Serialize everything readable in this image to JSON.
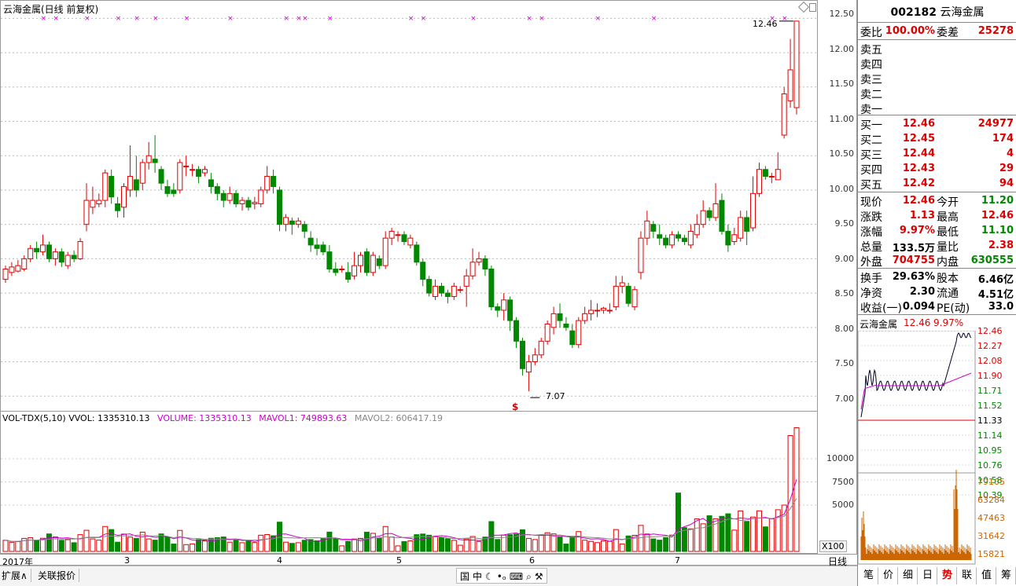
{
  "chart_header": {
    "title": "云海金属(日线 前复权)"
  },
  "price_axis": {
    "ticks": [
      "12.50",
      "12.00",
      "11.50",
      "11.00",
      "10.50",
      "10.00",
      "9.50",
      "9.00",
      "8.50",
      "8.00",
      "7.50",
      "7.00"
    ]
  },
  "vol_header": {
    "name": "VOL-TDX(5,10)",
    "vvol": "VVOL: 1335310.13",
    "volume": "VOLUME: 1335310.13",
    "mavol1": "MAVOL1: 749893.63",
    "mavol2": "MAVOL2: 606417.19"
  },
  "vol_axis": {
    "ticks": [
      "10000",
      "7500",
      "5000"
    ],
    "unit": "X100"
  },
  "annotations": {
    "high_label": "12.46",
    "low_label": "7.07",
    "signal": "$"
  },
  "dates": [
    "2017年",
    "3",
    "4",
    "5",
    "6",
    "7"
  ],
  "bottom_bar": {
    "left_buttons": [
      "扩展∧",
      "关联报价"
    ],
    "right_label": "日线",
    "tools": [
      "国",
      "中",
      "☾",
      "•ₒ",
      "⌨",
      "⌕",
      "⚒"
    ]
  },
  "quote": {
    "code": "002182",
    "name": "云海金属",
    "weibi_label": "委比",
    "weibi": "100.00%",
    "weicha_label": "委差",
    "weicha": "25278",
    "asks": [
      {
        "label": "卖五"
      },
      {
        "label": "卖四"
      },
      {
        "label": "卖三"
      },
      {
        "label": "卖二"
      },
      {
        "label": "卖一"
      }
    ],
    "bids": [
      {
        "label": "买一",
        "price": "12.46",
        "vol": "24977"
      },
      {
        "label": "买二",
        "price": "12.45",
        "vol": "174"
      },
      {
        "label": "买三",
        "price": "12.44",
        "vol": "4"
      },
      {
        "label": "买四",
        "price": "12.43",
        "vol": "29"
      },
      {
        "label": "买五",
        "price": "12.42",
        "vol": "94"
      }
    ],
    "stats": [
      {
        "l1": "现价",
        "v1": "12.46",
        "c1": "red",
        "l2": "今开",
        "v2": "11.20",
        "c2": "green"
      },
      {
        "l1": "涨跌",
        "v1": "1.13",
        "c1": "red",
        "l2": "最高",
        "v2": "12.46",
        "c2": "red"
      },
      {
        "l1": "涨幅",
        "v1": "9.97%",
        "c1": "red",
        "l2": "最低",
        "v2": "11.10",
        "c2": "green"
      },
      {
        "l1": "总量",
        "v1": "133.5万",
        "c1": "dark",
        "l2": "量比",
        "v2": "2.38",
        "c2": "red"
      },
      {
        "l1": "外盘",
        "v1": "704755",
        "c1": "red",
        "l2": "内盘",
        "v2": "630555",
        "c2": "green"
      }
    ],
    "stats2": [
      {
        "l1": "换手",
        "v1": "29.63%",
        "l2": "股本",
        "v2": "6.46亿"
      },
      {
        "l1": "净资",
        "v1": "2.30",
        "l2": "流通",
        "v2": "4.51亿"
      },
      {
        "l1": "收益(一)",
        "v1": "0.094",
        "l2": "PE(动)",
        "v2": "33.0"
      }
    ]
  },
  "mini_chart": {
    "name": "云海金属",
    "price": "12.46",
    "pct": "9.97%",
    "price_ticks": [
      "12.46",
      "12.27",
      "12.08",
      "11.90",
      "11.71",
      "11.52",
      "11.33",
      "11.14",
      "10.95",
      "10.76",
      "10.58",
      "10.39"
    ],
    "vol_ticks": [
      "79105",
      "63284",
      "47463",
      "31642",
      "15821"
    ]
  },
  "side_tabs": [
    "笔",
    "价",
    "细",
    "日",
    "势",
    "联",
    "值",
    "筹"
  ],
  "chart_data": {
    "type": "candlestick",
    "title": "云海金属(日线 前复权)",
    "ylim": [
      6.9,
      12.55
    ],
    "candles": [
      [
        8.7,
        8.85,
        8.9,
        8.65
      ],
      [
        8.8,
        8.88,
        8.95,
        8.75
      ],
      [
        8.82,
        8.9,
        8.98,
        8.8
      ],
      [
        8.85,
        9.0,
        9.05,
        8.82
      ],
      [
        9.0,
        9.15,
        9.2,
        8.95
      ],
      [
        9.15,
        9.1,
        9.25,
        9.0
      ],
      [
        9.1,
        9.2,
        9.35,
        9.05
      ],
      [
        9.2,
        9.0,
        9.25,
        8.95
      ],
      [
        9.0,
        9.1,
        9.15,
        8.9
      ],
      [
        9.1,
        8.95,
        9.15,
        8.88
      ],
      [
        8.9,
        9.05,
        9.1,
        8.85
      ],
      [
        9.05,
        9.0,
        9.12,
        8.95
      ],
      [
        9.0,
        9.25,
        9.3,
        8.98
      ],
      [
        9.5,
        9.85,
        10.1,
        9.4
      ],
      [
        9.75,
        9.85,
        10.05,
        9.65
      ],
      [
        9.8,
        9.85,
        9.95,
        9.75
      ],
      [
        9.85,
        10.25,
        10.3,
        9.75
      ],
      [
        10.2,
        9.9,
        10.3,
        9.8
      ],
      [
        9.8,
        9.7,
        9.9,
        9.6
      ],
      [
        9.75,
        10.05,
        10.1,
        9.6
      ],
      [
        10.0,
        10.2,
        10.65,
        9.9
      ],
      [
        10.15,
        10.0,
        10.5,
        9.9
      ],
      [
        10.1,
        10.4,
        10.45,
        10.0
      ],
      [
        10.4,
        10.5,
        10.7,
        10.3
      ],
      [
        10.45,
        10.4,
        10.8,
        10.25
      ],
      [
        10.3,
        10.1,
        10.35,
        10.0
      ],
      [
        10.05,
        9.95,
        10.15,
        9.9
      ],
      [
        10.0,
        9.95,
        10.1,
        9.9
      ],
      [
        10.0,
        10.4,
        10.45,
        9.95
      ],
      [
        10.35,
        10.35,
        10.5,
        10.2
      ],
      [
        10.3,
        10.3,
        10.38,
        10.2
      ],
      [
        10.3,
        10.2,
        10.35,
        10.1
      ],
      [
        10.25,
        10.3,
        10.35,
        10.2
      ],
      [
        10.15,
        10.05,
        10.25,
        9.95
      ],
      [
        10.05,
        9.95,
        10.1,
        9.85
      ],
      [
        9.95,
        9.85,
        10.0,
        9.75
      ],
      [
        9.85,
        9.95,
        10.05,
        9.8
      ],
      [
        9.95,
        9.8,
        10.0,
        9.75
      ],
      [
        9.8,
        9.85,
        9.9,
        9.7
      ],
      [
        9.85,
        9.75,
        9.9,
        9.7
      ],
      [
        9.8,
        9.82,
        9.9,
        9.72
      ],
      [
        9.8,
        10.0,
        10.05,
        9.75
      ],
      [
        10.0,
        10.2,
        10.35,
        9.95
      ],
      [
        10.2,
        10.05,
        10.3,
        9.95
      ],
      [
        10.0,
        9.5,
        10.05,
        9.4
      ],
      [
        9.5,
        9.6,
        9.65,
        9.4
      ],
      [
        9.55,
        9.5,
        9.6,
        9.35
      ],
      [
        9.5,
        9.55,
        9.6,
        9.45
      ],
      [
        9.5,
        9.4,
        9.55,
        9.3
      ],
      [
        9.3,
        9.2,
        9.4,
        9.1
      ],
      [
        9.2,
        9.15,
        9.3,
        9.05
      ],
      [
        9.2,
        9.1,
        9.25,
        9.05
      ],
      [
        9.1,
        8.85,
        9.2,
        8.8
      ],
      [
        8.85,
        8.8,
        8.95,
        8.75
      ],
      [
        8.85,
        8.85,
        8.9,
        8.8
      ],
      [
        8.8,
        8.7,
        8.95,
        8.65
      ],
      [
        8.75,
        8.9,
        9.1,
        8.7
      ],
      [
        8.9,
        9.05,
        9.1,
        8.8
      ],
      [
        9.1,
        8.8,
        9.15,
        8.75
      ],
      [
        8.8,
        9.05,
        9.1,
        8.75
      ],
      [
        9.0,
        8.9,
        9.05,
        8.85
      ],
      [
        8.9,
        9.3,
        9.4,
        8.85
      ],
      [
        9.3,
        9.4,
        9.45,
        9.2
      ],
      [
        9.35,
        9.35,
        9.4,
        9.25
      ],
      [
        9.35,
        9.25,
        9.4,
        9.2
      ],
      [
        9.2,
        9.3,
        9.35,
        9.15
      ],
      [
        9.2,
        8.95,
        9.25,
        8.9
      ],
      [
        8.95,
        8.7,
        9.0,
        8.6
      ],
      [
        8.7,
        8.5,
        8.75,
        8.45
      ],
      [
        8.45,
        8.6,
        8.7,
        8.4
      ],
      [
        8.6,
        8.5,
        8.65,
        8.45
      ],
      [
        8.5,
        8.45,
        8.55,
        8.35
      ],
      [
        8.45,
        8.6,
        8.65,
        8.4
      ],
      [
        8.55,
        8.55,
        8.6,
        8.5
      ],
      [
        8.6,
        8.75,
        8.85,
        8.3
      ],
      [
        8.75,
        8.95,
        9.15,
        8.7
      ],
      [
        8.95,
        9.0,
        9.1,
        8.9
      ],
      [
        9.0,
        8.85,
        9.05,
        8.75
      ],
      [
        8.85,
        8.3,
        8.9,
        8.25
      ],
      [
        8.3,
        8.25,
        8.35,
        8.15
      ],
      [
        8.25,
        8.4,
        8.5,
        8.1
      ],
      [
        8.4,
        8.1,
        8.45,
        7.95
      ],
      [
        8.1,
        7.8,
        8.15,
        7.7
      ],
      [
        7.8,
        7.4,
        7.85,
        7.3
      ],
      [
        7.35,
        7.5,
        7.6,
        7.07
      ],
      [
        7.5,
        7.6,
        7.7,
        7.45
      ],
      [
        7.6,
        7.8,
        7.85,
        7.55
      ],
      [
        7.8,
        8.05,
        8.1,
        7.75
      ],
      [
        8.0,
        8.2,
        8.3,
        7.9
      ],
      [
        8.2,
        8.1,
        8.35,
        8.0
      ],
      [
        8.05,
        8.0,
        8.15,
        7.95
      ],
      [
        7.95,
        7.75,
        8.05,
        7.7
      ],
      [
        7.75,
        8.1,
        8.15,
        7.7
      ],
      [
        8.1,
        8.2,
        8.3,
        8.05
      ],
      [
        8.2,
        8.25,
        8.4,
        8.1
      ],
      [
        8.25,
        8.25,
        8.35,
        8.15
      ],
      [
        8.25,
        8.28,
        8.3,
        8.2
      ],
      [
        8.25,
        8.25,
        8.35,
        8.2
      ],
      [
        8.3,
        8.6,
        8.75,
        8.25
      ],
      [
        8.6,
        8.65,
        8.75,
        8.5
      ],
      [
        8.6,
        8.35,
        8.65,
        8.3
      ],
      [
        8.3,
        8.55,
        8.6,
        8.25
      ],
      [
        8.8,
        9.3,
        9.4,
        8.7
      ],
      [
        9.3,
        9.55,
        9.7,
        9.2
      ],
      [
        9.5,
        9.4,
        9.55,
        9.3
      ],
      [
        9.35,
        9.3,
        9.5,
        9.2
      ],
      [
        9.3,
        9.2,
        9.35,
        9.15
      ],
      [
        9.2,
        9.35,
        9.4,
        9.15
      ],
      [
        9.35,
        9.3,
        9.4,
        9.25
      ],
      [
        9.3,
        9.25,
        9.35,
        9.2
      ],
      [
        9.2,
        9.4,
        9.5,
        9.15
      ],
      [
        9.35,
        9.5,
        9.65,
        9.3
      ],
      [
        9.5,
        9.7,
        9.85,
        9.45
      ],
      [
        9.7,
        9.6,
        9.75,
        9.55
      ],
      [
        9.6,
        9.8,
        10.1,
        9.55
      ],
      [
        9.85,
        9.4,
        9.95,
        9.35
      ],
      [
        9.4,
        9.2,
        9.5,
        9.1
      ],
      [
        9.25,
        9.35,
        9.45,
        9.2
      ],
      [
        9.3,
        9.6,
        9.7,
        9.25
      ],
      [
        9.6,
        9.4,
        9.7,
        9.2
      ],
      [
        9.45,
        9.95,
        10.2,
        9.4
      ],
      [
        9.95,
        10.3,
        10.4,
        9.9
      ],
      [
        10.3,
        10.2,
        10.35,
        10.15
      ],
      [
        10.2,
        10.2,
        10.25,
        10.1
      ],
      [
        10.15,
        10.3,
        10.55,
        10.15
      ],
      [
        10.8,
        11.4,
        11.5,
        10.75
      ],
      [
        11.3,
        11.75,
        12.2,
        11.2
      ],
      [
        11.2,
        12.46,
        12.46,
        11.1
      ]
    ],
    "volume_unit": "X100",
    "volume_ticks": [
      10000,
      7500,
      5000
    ],
    "last_volume": 1335310.13,
    "mavol1": 749893.63,
    "mavol2": 606417.19
  }
}
